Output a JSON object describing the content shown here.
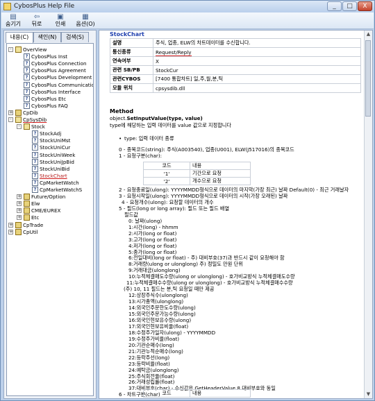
{
  "window": {
    "title": "CybosPlus Help File"
  },
  "titlebar_buttons": [
    "_",
    "□",
    "X"
  ],
  "toolbar": [
    {
      "label": "숨기기",
      "icon": "hide-icon"
    },
    {
      "label": "뒤로",
      "icon": "back-icon"
    },
    {
      "label": "인쇄",
      "icon": "print-icon"
    },
    {
      "label": "옵션(O)",
      "icon": "options-icon"
    }
  ],
  "tabs": [
    "내용(C)",
    "색인(N)",
    "검색(S)"
  ],
  "tree": [
    {
      "label": "OverView",
      "type": "bookopen",
      "level": 0,
      "exp": "-"
    },
    {
      "label": "CybosPlus Inst",
      "type": "page",
      "level": 1
    },
    {
      "label": "CybosPlus Connection",
      "type": "page",
      "level": 1
    },
    {
      "label": "CybosPlus Agreement",
      "type": "page",
      "level": 1
    },
    {
      "label": "CybosPlus Development",
      "type": "page",
      "level": 1
    },
    {
      "label": "CybosPlus Communication",
      "type": "page",
      "level": 1
    },
    {
      "label": "CybosPlus Interface",
      "type": "page",
      "level": 1
    },
    {
      "label": "CybosPlus Etc",
      "type": "page",
      "level": 1
    },
    {
      "label": "CybosPlus FAQ",
      "type": "page",
      "level": 1
    },
    {
      "label": "CpDib",
      "type": "book",
      "level": 0,
      "exp": "+"
    },
    {
      "label": "CpSysDib",
      "type": "bookopen",
      "level": 0,
      "exp": "-",
      "red": true
    },
    {
      "label": "Stock",
      "type": "bookopen",
      "level": 1,
      "exp": "-"
    },
    {
      "label": "StockAdj",
      "type": "page",
      "level": 2
    },
    {
      "label": "StockUniMst",
      "type": "page",
      "level": 2
    },
    {
      "label": "StockUniCur",
      "type": "page",
      "level": 2
    },
    {
      "label": "StockUniWeek",
      "type": "page",
      "level": 2
    },
    {
      "label": "StockUniJpBid",
      "type": "page",
      "level": 2
    },
    {
      "label": "StockUniBid",
      "type": "page",
      "level": 2
    },
    {
      "label": "StockChart",
      "type": "page",
      "level": 2,
      "selected": true
    },
    {
      "label": "CpMarketWatch",
      "type": "page",
      "level": 2
    },
    {
      "label": "CpMarketWatchS",
      "type": "page",
      "level": 2
    },
    {
      "label": "Future/Option",
      "type": "book",
      "level": 1,
      "exp": "+"
    },
    {
      "label": "Elw",
      "type": "book",
      "level": 1,
      "exp": "+"
    },
    {
      "label": "CME/EUREX",
      "type": "book",
      "level": 1,
      "exp": "+"
    },
    {
      "label": "Etc",
      "type": "book",
      "level": 1,
      "exp": "+"
    },
    {
      "label": "CpTrade",
      "type": "book",
      "level": 0,
      "exp": "+"
    },
    {
      "label": "CpUtil",
      "type": "book",
      "level": 0,
      "exp": "+"
    }
  ],
  "doc": {
    "heading": "StockChart",
    "info": [
      {
        "k": "설명",
        "v": "주식, 업종, ELW의 차트데이터를 수신합니다."
      },
      {
        "k": "통신종류",
        "v": "Request/Reply"
      },
      {
        "k": "연속여부",
        "v": "X"
      },
      {
        "k": "관련 SB/PB",
        "v": "StockCur"
      },
      {
        "k": "관련CYBOS",
        "v": "[7400 통합차트] 일,주,월,분,틱"
      },
      {
        "k": "모듈 위치",
        "v": "cpsysdib.dll"
      }
    ],
    "method_title": "Method",
    "method_sig_prefix": "object.",
    "method_sig": "SetInputValue(type, value)",
    "method_desc": "type에 해당하는 입력 데이터를 value 값으로 지정합니다",
    "type_bullet": "type: 입력 데이터 종류",
    "lines1": [
      "0 - 종목코드(string): 주식(A003540), 업종(U001), ELW(J517016)의 종목코드",
      "1 - 요청구분(char):"
    ],
    "table1": {
      "head": [
        "코드",
        "내용"
      ],
      "rows": [
        [
          "'1'",
          "기간으로 요청"
        ],
        [
          "'2'",
          "개수으로 요청"
        ]
      ]
    },
    "lines2": [
      "2 - 요청종료일(ulong): YYYYMMDD형식으로 데이터의 마지막(가장 최근) 날짜 Default(0) - 최근 거래날자",
      "3 - 요청시작일(ulong): YYYYMMDD형식으로 데이터의 시작(가장 오래된) 날짜",
      "4 - 요청개수(ulong): 요청할 데이터의 개수",
      "5 - 필드(long or long array): 필드 또는 필드 배열",
      "필드값",
      "0: 날짜(ulong)",
      "1:시간(long) - hhmm",
      "2:시가(long or float)",
      "3:고가(long or float)",
      "4:저가(long or float)",
      "5:종가(long or float)",
      "6:전일대비(long or float) - 주) 대비부호(37)과 반드시 같이 요청해야 함",
      "8:거래량(ulong or ulonglong) 주) 정밀도 만원 단위",
      "9:거래대금(ulonglong)",
      "10:누적체결매도수량(ulong or ulonglong) - 호가비교방식 누적체결매도수량",
      "11:누적체결매수수량(ulong or ulonglong) - 호가비교방식 누적체결매수수량",
      "(주) 10, 11 필드는 분,틱 요청일 때만 제공",
      "12:상장주식수(ulonglong)",
      "13:시가총액(ulonglong)",
      "14:외국인주문한도수량(ulong)",
      "15:외국인주문가능수량(ulong)",
      "16:외국인현보유수량(ulong)",
      "17:외국인현보유비율(float)",
      "18:수정주가일자(ulong) - YYYYMMDD",
      "19:수정주가비율(float)",
      "20:기관순매수(long)",
      "21:기관누적순매수(long)",
      "22:등락주선(long)",
      "23:등락비율(float)",
      "24:예탁금(ulonglong)",
      "25:주식회전율(float)",
      "26:거래성립률(float)",
      "37:대비부호(char) - 수신값은 GetHeaderValue 8 대비부호와 동일",
      "6 - 차트구분(char)"
    ],
    "table2": {
      "head": [
        "코드",
        "내용"
      ]
    }
  }
}
